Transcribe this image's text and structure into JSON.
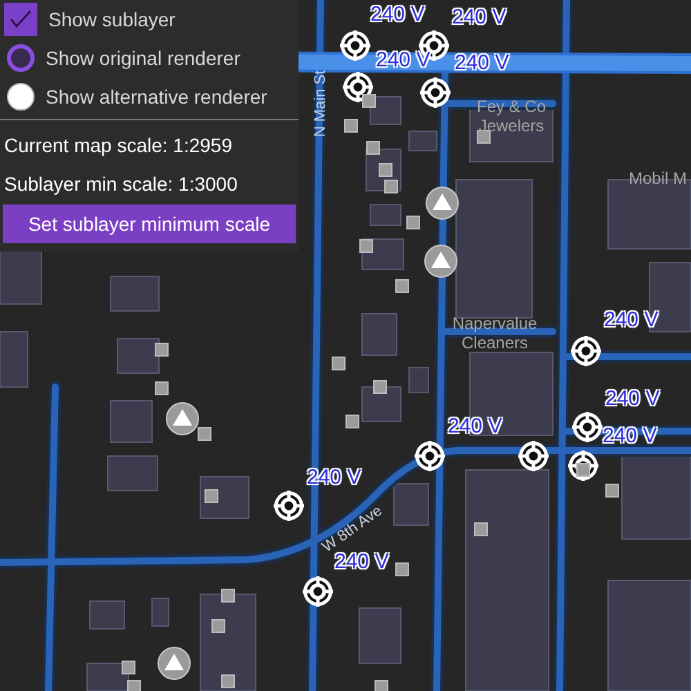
{
  "panel": {
    "options": [
      {
        "kind": "checkbox",
        "label": "Show sublayer",
        "checked": true
      },
      {
        "kind": "radio",
        "label": "Show original renderer",
        "selected": true
      },
      {
        "kind": "radio",
        "label": "Show alternative renderer",
        "selected": false
      }
    ],
    "current_scale": "Current map scale: 1:2959",
    "min_scale": "Sublayer min scale: 1:3000",
    "button": "Set sublayer minimum scale"
  },
  "map": {
    "voltage_labels": [
      "240 V",
      "240 V",
      "240 V",
      "240 V",
      "240 V",
      "240 V",
      "240 V",
      "240 V",
      "240 V",
      "240 V"
    ],
    "street_labels": [
      "N Main St",
      "W 8th Ave"
    ],
    "place_labels": [
      {
        "lines": [
          "Fey & Co",
          "Jewelers"
        ]
      },
      {
        "lines": [
          "Napervalue",
          "Cleaners"
        ]
      },
      {
        "lines": [
          "Mobil M"
        ]
      }
    ]
  }
}
